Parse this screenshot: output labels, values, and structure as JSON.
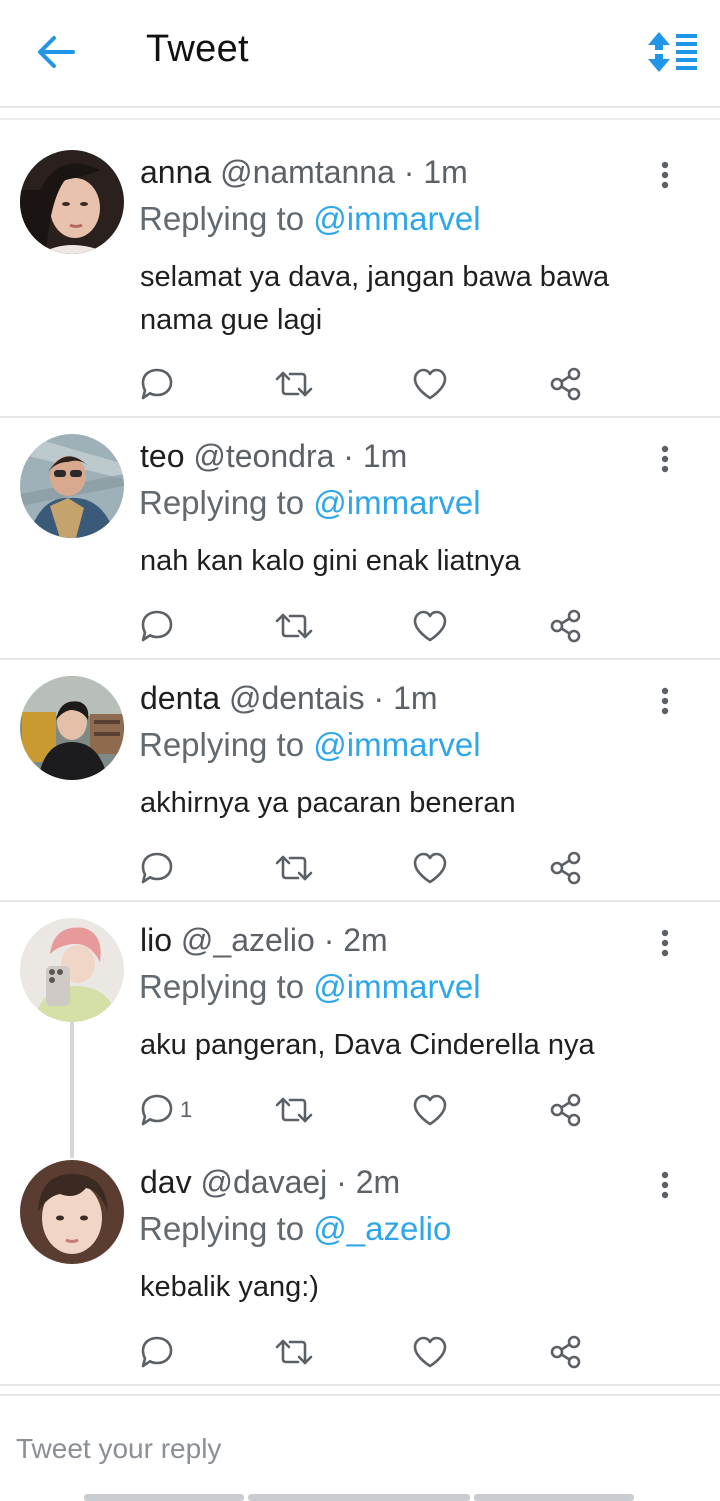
{
  "header": {
    "title": "Tweet",
    "back_icon": "arrow-left-icon",
    "sort_icon": "sort-toggle-icon",
    "accent": "#1d9bf0"
  },
  "replies": [
    {
      "name": "anna",
      "handle": "@namtanna",
      "sep": "·",
      "time": "1m",
      "replying_prefix": "Replying to",
      "replying_to": "@immarvel",
      "text": "selamat ya dava, jangan bawa bawa nama gue lagi",
      "reply_count": ""
    },
    {
      "name": "teo",
      "handle": "@teondra",
      "sep": "·",
      "time": "1m",
      "replying_prefix": "Replying to",
      "replying_to": "@immarvel",
      "text": "nah kan kalo gini enak liatnya",
      "reply_count": ""
    },
    {
      "name": "denta",
      "handle": "@dentais",
      "sep": "·",
      "time": "1m",
      "replying_prefix": "Replying to",
      "replying_to": "@immarvel",
      "text": "akhirnya ya pacaran beneran",
      "reply_count": ""
    },
    {
      "name": "lio",
      "handle": "@_azelio",
      "sep": "·",
      "time": "2m",
      "replying_prefix": "Replying to",
      "replying_to": "@immarvel",
      "text": "aku pangeran, Dava Cinderella nya",
      "reply_count": "1"
    },
    {
      "name": "dav",
      "handle": "@davaej",
      "sep": "·",
      "time": "2m",
      "replying_prefix": "Replying to",
      "replying_to": "@_azelio",
      "text": "kebalik yang:)",
      "reply_count": ""
    }
  ],
  "action_icons": [
    "comment-icon",
    "retweet-icon",
    "like-icon",
    "share-icon"
  ],
  "compose": {
    "placeholder": "Tweet your reply"
  },
  "colors": {
    "mention": "#2fa6e9",
    "muted": "#5b6166",
    "divider": "#e4e6e8"
  }
}
